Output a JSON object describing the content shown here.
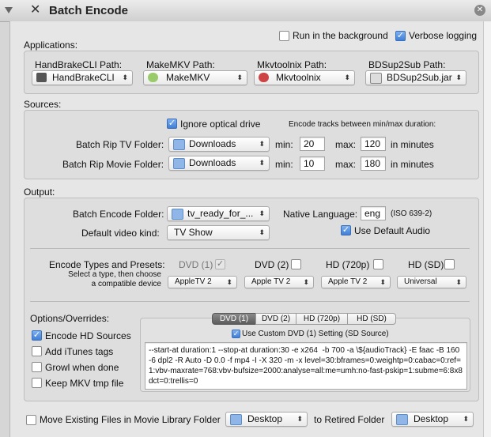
{
  "window": {
    "title": "Batch Encode"
  },
  "applications": {
    "label": "Applications:",
    "run_in_background": {
      "label": "Run in the background",
      "checked": false
    },
    "verbose_logging": {
      "label": "Verbose logging",
      "checked": true
    },
    "handbrake": {
      "label": "HandBrakeCLI Path:",
      "value": "HandBrakeCLI"
    },
    "makemkv": {
      "label": "MakeMKV Path:",
      "value": "MakeMKV"
    },
    "mkvtoolnix": {
      "label": "Mkvtoolnix Path:",
      "value": "Mkvtoolnix"
    },
    "bdsup2sub": {
      "label": "BDSup2Sub Path:",
      "value": "BDSup2Sub.jar"
    }
  },
  "sources": {
    "label": "Sources:",
    "ignore_optical": {
      "label": "Ignore optical drive",
      "checked": true
    },
    "encode_tracks_label": "Encode tracks between min/max duration:",
    "tv": {
      "label": "Batch Rip TV Folder:",
      "folder": "Downloads",
      "min_label": "min:",
      "min": "20",
      "max_label": "max:",
      "max": "120",
      "unit": "in minutes"
    },
    "movie": {
      "label": "Batch Rip Movie Folder:",
      "folder": "Downloads",
      "min_label": "min:",
      "min": "10",
      "max_label": "max:",
      "max": "180",
      "unit": "in minutes"
    }
  },
  "output": {
    "label": "Output:",
    "encode_folder": {
      "label": "Batch Encode Folder:",
      "value": "tv_ready_for_..."
    },
    "native_language": {
      "label": "Native Language:",
      "value": "eng",
      "hint": "(ISO 639-2)"
    },
    "default_video_kind": {
      "label": "Default video kind:",
      "value": "TV Show"
    },
    "use_default_audio": {
      "label": "Use Default Audio",
      "checked": true
    },
    "encode_types_label": "Encode Types and Presets:",
    "encode_types_sub": "Select a type, then choose a compatible device",
    "types": [
      {
        "label": "DVD (1)",
        "checked": true,
        "disabled": true,
        "preset": "AppleTV 2"
      },
      {
        "label": "DVD (2)",
        "checked": false,
        "disabled": false,
        "preset": "Apple TV 2"
      },
      {
        "label": "HD (720p)",
        "checked": false,
        "disabled": false,
        "preset": "Apple TV 2"
      },
      {
        "label": "HD (SD)",
        "checked": false,
        "disabled": false,
        "preset": "Universal"
      }
    ]
  },
  "overrides": {
    "label": "Options/Overrides:",
    "options": [
      {
        "label": "Encode HD Sources",
        "checked": true
      },
      {
        "label": "Add iTunes tags",
        "checked": false
      },
      {
        "label": "Growl when done",
        "checked": false
      },
      {
        "label": "Keep MKV tmp file",
        "checked": false
      }
    ],
    "tabs": [
      "DVD (1)",
      "DVD (2)",
      "HD (720p)",
      "HD (SD)"
    ],
    "selected_tab": "DVD (1)",
    "use_custom": {
      "label": "Use Custom DVD (1) Setting (SD Source)",
      "checked": true
    },
    "args": "--start-at duration:1 --stop-at duration:30 -e x264  -b 700 -a \\${audioTrack} -E faac -B 160 -6 dpl2 -R Auto -D 0.0 -f mp4 -I -X 320 -m -x level=30:bframes=0:weightp=0:cabac=0:ref=1:vbv-maxrate=768:vbv-bufsize=2000:analyse=all:me=umh:no-fast-pskip=1:subme=6:8x8dct=0:trellis=0"
  },
  "footer": {
    "move_existing": {
      "label": "Move Existing Files in Movie Library Folder",
      "checked": false
    },
    "from_folder": "Desktop",
    "to_label": "to Retired Folder",
    "to_folder": "Desktop"
  },
  "colors": {
    "accent": "#3f7fd6",
    "panel": "#e6e6e6",
    "group": "#dedede"
  }
}
